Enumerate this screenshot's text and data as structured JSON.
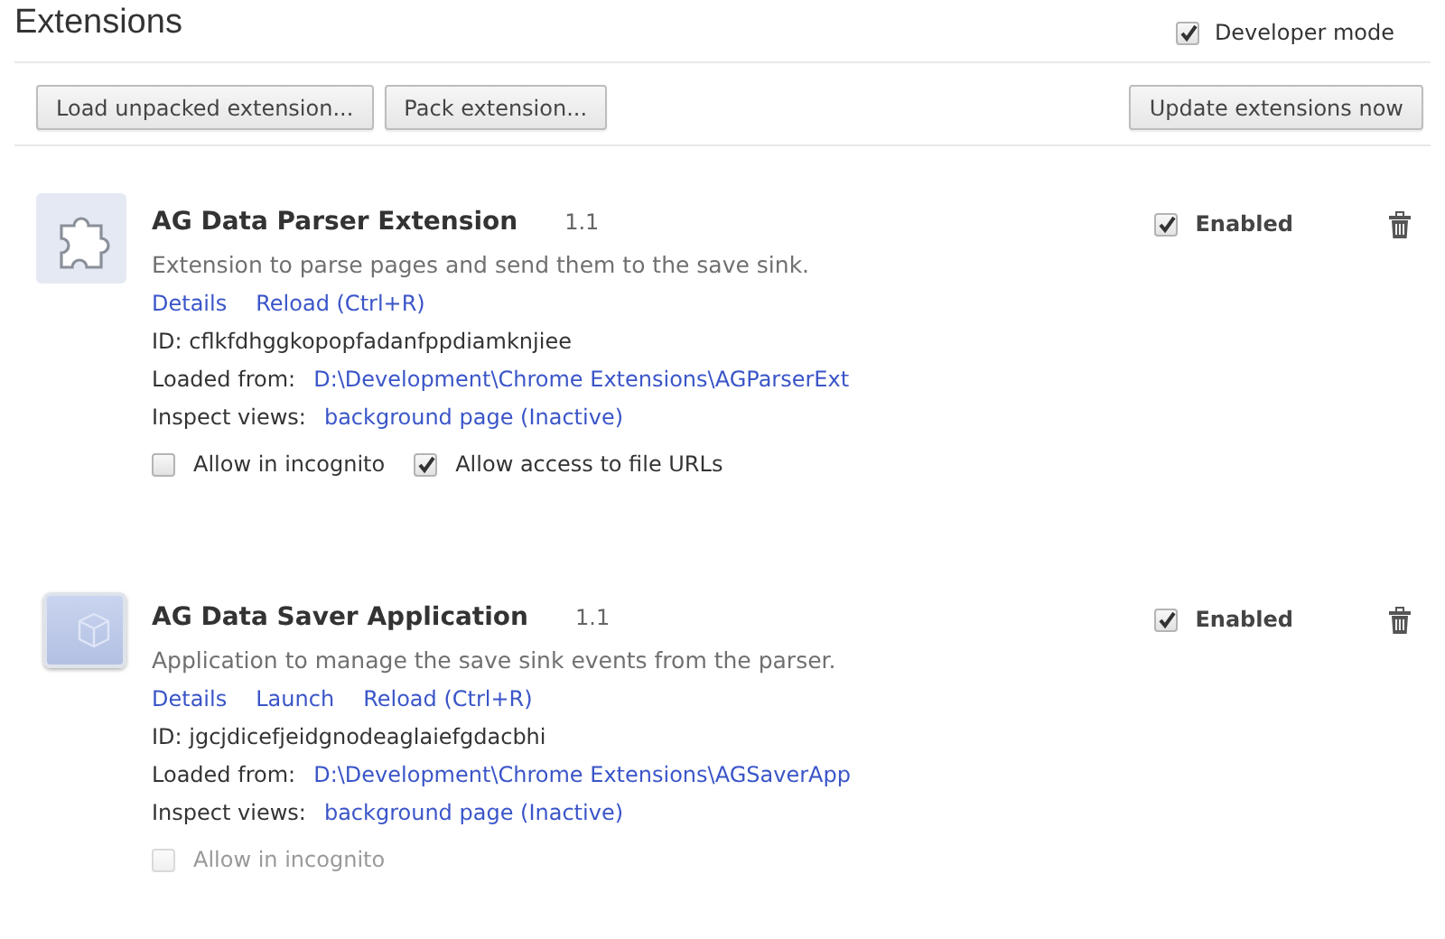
{
  "header": {
    "title": "Extensions",
    "developer_mode": {
      "label": "Developer mode",
      "checked": true
    }
  },
  "toolbar": {
    "left_buttons": [
      "Load unpacked extension...",
      "Pack extension..."
    ],
    "right_buttons": [
      "Update extensions now"
    ]
  },
  "extensions": [
    {
      "kind": "extension",
      "name": "AG Data Parser Extension",
      "version": "1.1",
      "description": "Extension to parse pages and send them to the save sink.",
      "links": [
        "Details",
        "Reload (Ctrl+R)"
      ],
      "id_line": "ID: cflkfdhggkopopfadanfppdiamknjiee",
      "loaded_label": "Loaded from:",
      "loaded_path": "D:\\Development\\Chrome Extensions\\AGParserExt",
      "inspect_label": "Inspect views:",
      "inspect_link": "background page (Inactive)",
      "options": [
        {
          "label": "Allow in incognito",
          "checked": false,
          "disabled": false
        },
        {
          "label": "Allow access to file URLs",
          "checked": true,
          "disabled": false
        }
      ],
      "enabled": {
        "label": "Enabled",
        "checked": true
      }
    },
    {
      "kind": "app",
      "name": "AG Data Saver Application",
      "version": "1.1",
      "description": "Application to manage the save sink events from the parser.",
      "links": [
        "Details",
        "Launch",
        "Reload (Ctrl+R)"
      ],
      "id_line": "ID: jgcjdicefjeidgnodeaglaiefgdacbhi",
      "loaded_label": "Loaded from:",
      "loaded_path": "D:\\Development\\Chrome Extensions\\AGSaverApp",
      "inspect_label": "Inspect views:",
      "inspect_link": "background page (Inactive)",
      "options": [
        {
          "label": "Allow in incognito",
          "checked": false,
          "disabled": true
        }
      ],
      "enabled": {
        "label": "Enabled",
        "checked": true
      }
    }
  ]
}
